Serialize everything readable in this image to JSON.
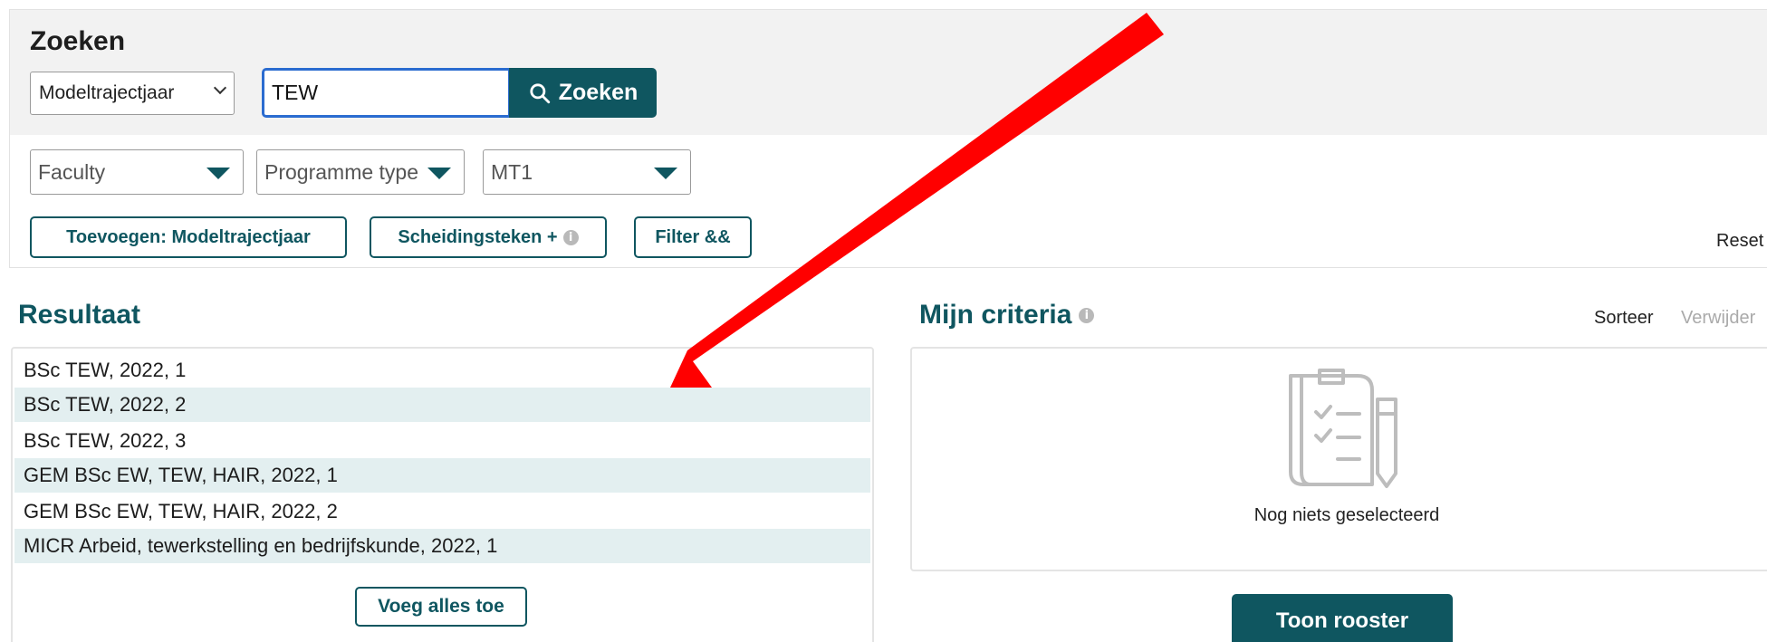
{
  "search": {
    "title": "Zoeken",
    "mode_select": "Modeltrajectjaar",
    "query_value": "TEW",
    "button_label": "Zoeken"
  },
  "filters": {
    "faculty": "Faculty",
    "programme_type": "Programme type",
    "mt": "MT1"
  },
  "actions": {
    "add_label": "Toevoegen: Modeltrajectjaar",
    "separator_label": "Scheidingsteken +",
    "filter_label": "Filter &&",
    "reset_label": "Reset"
  },
  "results": {
    "title": "Resultaat",
    "items": [
      "BSc TEW, 2022, 1",
      "BSc TEW, 2022, 2",
      "BSc TEW, 2022, 3",
      "GEM BSc EW, TEW, HAIR, 2022, 1",
      "GEM BSc EW, TEW, HAIR, 2022, 2",
      "MICR Arbeid, tewerkstelling en bedrijfskunde, 2022, 1"
    ],
    "add_all_label": "Voeg alles toe"
  },
  "criteria": {
    "title": "Mijn criteria",
    "sort_label": "Sorteer",
    "remove_label": "Verwijder",
    "empty_text": "Nog niets geselecteerd",
    "show_label": "Toon rooster"
  },
  "colors": {
    "brand": "#0f5660",
    "row_highlight": "#e3eff0",
    "arrow": "#ff0000",
    "focus": "#2b6cd0"
  },
  "icons": {
    "search": "magnifier-icon",
    "info": "info-icon",
    "empty": "clipboard-pencil-icon"
  }
}
